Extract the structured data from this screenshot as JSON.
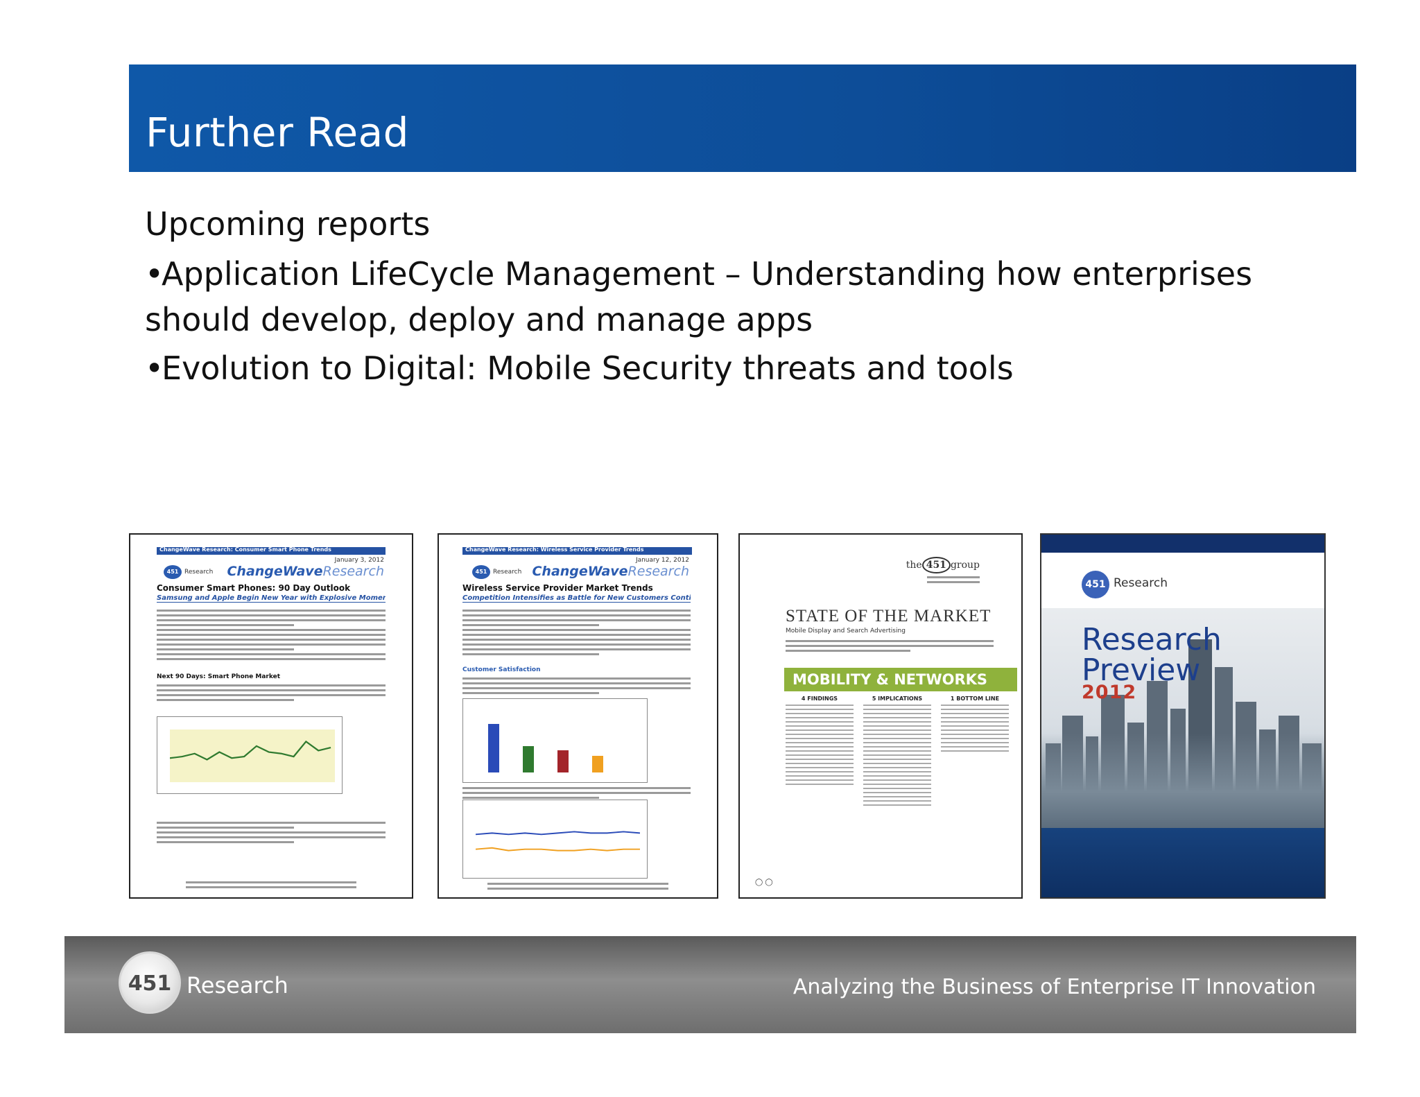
{
  "slide": {
    "title": "Further Read",
    "heading": "Upcoming reports",
    "bullets": [
      "Application LifeCycle Management – Understanding how enterprises should develop, deploy and manage apps",
      "Evolution to Digital: Mobile Security threats and tools"
    ]
  },
  "thumbnails": [
    {
      "band": "ChangeWave Research: Consumer Smart Phone Trends",
      "date": "January 3, 2012",
      "logo_small": "451",
      "logo_small_text": "Research",
      "brand": "ChangeWave",
      "brand_light": "Research",
      "title": "Consumer Smart Phones: 90 Day Outlook",
      "subtitle": "Samsung and Apple Begin New Year with Explosive Momentum",
      "section": "Next 90 Days: Smart Phone Market"
    },
    {
      "band": "ChangeWave Research: Wireless Service Provider Trends",
      "date": "January 12, 2012",
      "logo_small": "451",
      "logo_small_text": "Research",
      "brand": "ChangeWave",
      "brand_light": "Research",
      "title": "Wireless Service Provider Market Trends",
      "subtitle": "Competition Intensifies as Battle for New Customers Continues",
      "section": "Customer Satisfaction"
    },
    {
      "logo": "451",
      "logo_pre": "the",
      "logo_post": "group",
      "title": "STATE OF THE MARKET",
      "subtitle": "Mobile Display and Search Advertising",
      "band": "MOBILITY & NETWORKS",
      "cols": [
        "4 FINDINGS",
        "5 IMPLICATIONS",
        "1 BOTTOM LINE"
      ]
    },
    {
      "logo": "451",
      "logo_text": "Research",
      "title_line1": "Research",
      "title_line2": "Preview",
      "year": "2012"
    }
  ],
  "footer": {
    "logo": "451",
    "brand": "Research",
    "tagline": "Analyzing the Business of Enterprise IT Innovation"
  },
  "colors": {
    "title_bar": "#0f58a8",
    "mobility_band": "#8fb23c",
    "research_blue": "#1d3f8c",
    "year_red": "#c0392b"
  }
}
